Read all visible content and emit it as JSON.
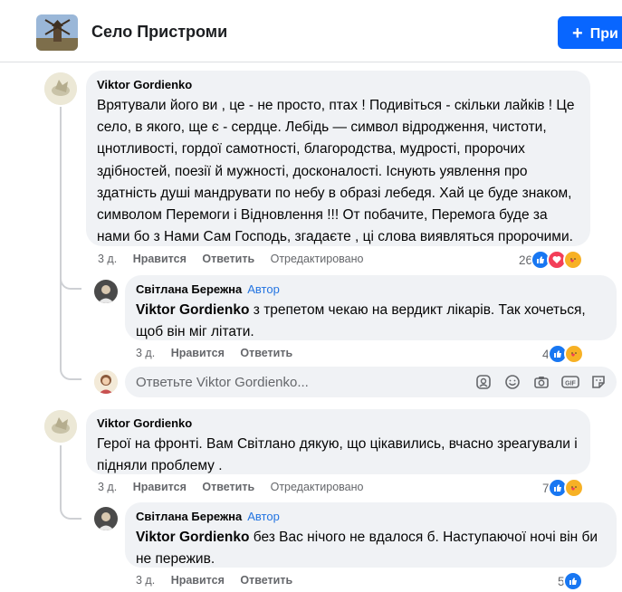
{
  "group": {
    "name": "Село Пристроми",
    "join_label": "При"
  },
  "comments": [
    {
      "author": "Viktor Gordienko",
      "text": "Врятували його ви , це - не просто, птах ! Подивіться - скільки лайків ! Це село, в якого, ще є - сердце. Лебідь — символ відродження, чистоти, цнотливості, гордої самотності, благородства, мудрості, пророчих здібностей, поезії й мужності, досконалості. Існують уявлення про здатність душі мандрувати по небу в образі лебедя. Хай це буде знаком, символом Перемоги і Відновлення !!! От побачите, Перемога буде за нами бо з Нами Сам Господь, згадаєте , ці слова виявляться пророчими.",
      "time": "3 д.",
      "like": "Нравится",
      "reply": "Ответить",
      "edited": "Отредактировано",
      "reaction_count": "26",
      "reactions": [
        "like-icon",
        "love-icon",
        "care-icon"
      ]
    },
    {
      "author": "Світлана Бережна",
      "badge": "Автор",
      "mention": "Viktor Gordienko",
      "text": " з трепетом чекаю на вердикт лікарів. Так хочеться, щоб він міг літати.",
      "time": "3 д.",
      "like": "Нравится",
      "reply": "Ответить",
      "reaction_count": "4",
      "reactions": [
        "like-icon",
        "care-icon"
      ]
    },
    {
      "author": "Viktor Gordienko",
      "text": "Герої на фронті. Вам Світлано дякую, що цікавились, вчасно зреагували і підняли проблему .",
      "time": "3 д.",
      "like": "Нравится",
      "reply": "Ответить",
      "edited": "Отредактировано",
      "reaction_count": "7",
      "reactions": [
        "like-icon",
        "care-icon"
      ]
    },
    {
      "author": "Світлана Бережна",
      "badge": "Автор",
      "mention": "Viktor Gordienko",
      "text": " без Вас нічого не вдалося б. Наступаючої ночі він би не пережив.",
      "time": "3 д.",
      "like": "Нравится",
      "reply": "Ответить",
      "reaction_count": "5",
      "reactions": [
        "like-icon"
      ]
    }
  ],
  "reply_box": {
    "placeholder": "Ответьте Viktor Gordienko...",
    "tools": [
      "sticker-avatar-icon",
      "emoji-icon",
      "camera-icon",
      "gif-icon",
      "sticker-icon"
    ]
  },
  "colors": {
    "accent": "#0866ff",
    "bubble": "#f0f2f5",
    "muted": "#65676b",
    "badge": "#2374e1"
  }
}
